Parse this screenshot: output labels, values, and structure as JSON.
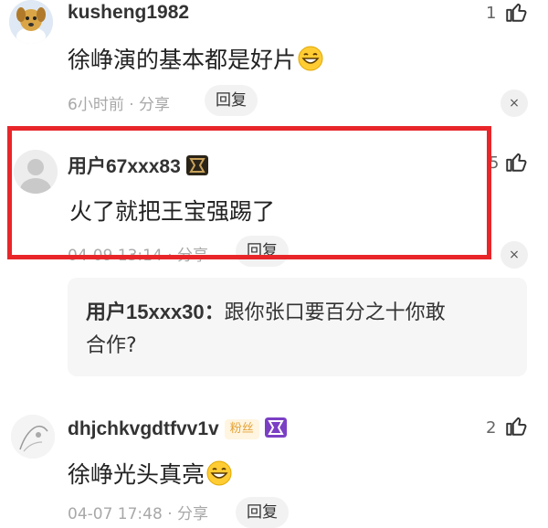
{
  "comments": [
    {
      "username": "kusheng1982",
      "content": "徐峥演的基本都是好片",
      "emoji": "grinning-emoji",
      "time": "6小时前",
      "separator": "·",
      "share": "分享",
      "reply_label": "回复",
      "likes": "1",
      "close": "×"
    },
    {
      "username": "用户67xxx83",
      "content": "火了就把王宝强踢了",
      "time": "04-09 13:14",
      "separator": "·",
      "share": "分享",
      "reply_label": "回复",
      "likes": "5",
      "close": "×",
      "badge_icon": "level-badge-icon",
      "reply": {
        "user": "用户15xxx30：",
        "text_line1": "跟你张口要百分之十你敢",
        "text_line2": "合作?"
      }
    },
    {
      "username": "dhjchkvgdtfvv1v",
      "fans_badge": "粉丝",
      "badge_icon": "level-badge-icon",
      "content": "徐峥光头真亮",
      "emoji": "grinning-emoji",
      "time": "04-07 17:48",
      "separator": "·",
      "share": "分享",
      "reply_label": "回复",
      "likes": "2"
    }
  ],
  "colors": {
    "highlight": "#e8262a",
    "badge_dark": "#2a2418",
    "badge_gold": "#c8a15a",
    "badge_purple": "#7b3fc4"
  }
}
